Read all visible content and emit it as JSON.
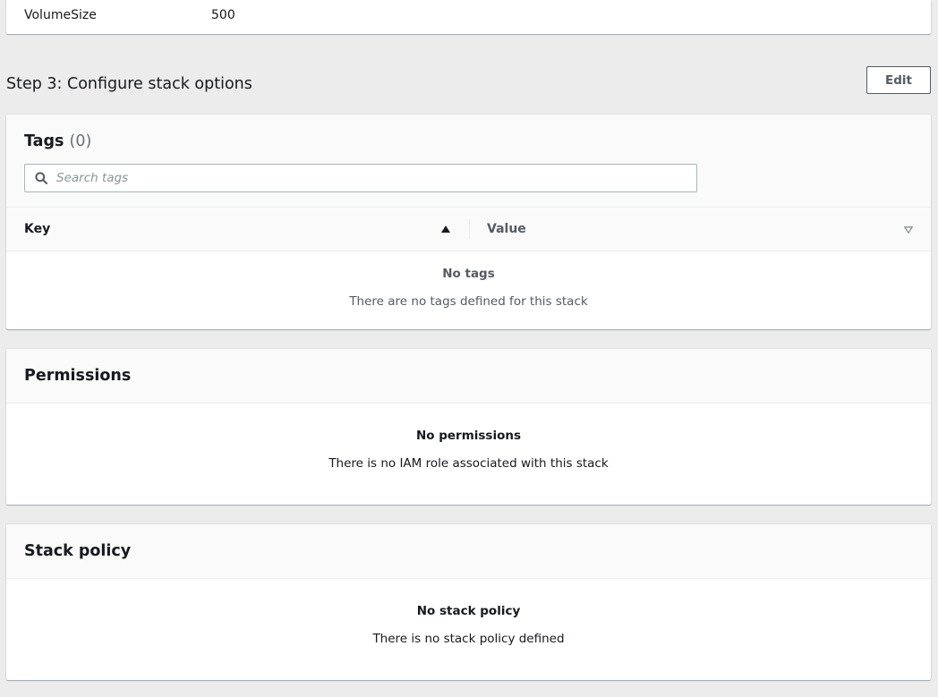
{
  "parameters": {
    "row": {
      "name": "VolumeSize",
      "value": "500"
    }
  },
  "step": {
    "title": "Step 3: Configure stack options",
    "edit_label": "Edit"
  },
  "tags": {
    "title": "Tags",
    "count": "(0)",
    "search_placeholder": "Search tags",
    "columns": {
      "key": "Key",
      "value": "Value"
    },
    "empty_title": "No tags",
    "empty_desc": "There are no tags defined for this stack"
  },
  "permissions": {
    "title": "Permissions",
    "empty_title": "No permissions",
    "empty_desc": "There is no IAM role associated with this stack"
  },
  "stack_policy": {
    "title": "Stack policy",
    "empty_title": "No stack policy",
    "empty_desc": "There is no stack policy defined"
  },
  "icons": {
    "search": "search-icon",
    "sort_asc": "caret-up-icon",
    "sort": "caret-down-icon"
  },
  "colors": {
    "background": "#ececec",
    "card": "#ffffff",
    "header": "#fafafa",
    "text": "#16191f",
    "secondary_text": "#545b64",
    "border": "#aab7b8"
  }
}
